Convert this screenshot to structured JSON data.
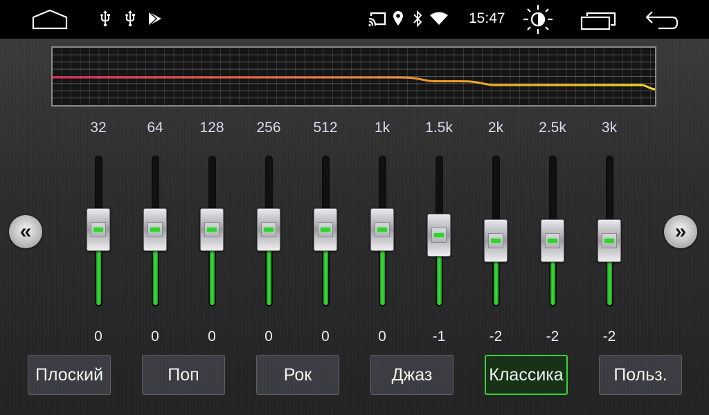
{
  "status_bar": {
    "left_icons": [
      "home-icon",
      "usb-icon",
      "usb-icon",
      "play-store-icon"
    ],
    "right_icons": [
      "cast-icon",
      "location-icon",
      "bluetooth-icon",
      "wifi-icon"
    ],
    "time": "15:47",
    "controls": [
      "brightness-icon",
      "recent-apps-icon",
      "back-icon"
    ]
  },
  "equalizer": {
    "range": {
      "min": -12,
      "max": 12
    },
    "bands": [
      {
        "freq": "32",
        "value": 0,
        "label": "0"
      },
      {
        "freq": "64",
        "value": 0,
        "label": "0"
      },
      {
        "freq": "128",
        "value": 0,
        "label": "0"
      },
      {
        "freq": "256",
        "value": 0,
        "label": "0"
      },
      {
        "freq": "512",
        "value": 0,
        "label": "0"
      },
      {
        "freq": "1k",
        "value": 0,
        "label": "0"
      },
      {
        "freq": "1.5k",
        "value": -1,
        "label": "-1"
      },
      {
        "freq": "2k",
        "value": -2,
        "label": "-2"
      },
      {
        "freq": "2.5k",
        "value": -2,
        "label": "-2"
      },
      {
        "freq": "3k",
        "value": -2,
        "label": "-2"
      }
    ],
    "curve_colors": {
      "start": "#e8245a",
      "mid": "#f08a30",
      "end": "#f3dc1c"
    },
    "prev_icon": "double-chevron-left-icon",
    "next_icon": "double-chevron-right-icon",
    "prev_glyph": "«",
    "next_glyph": "»"
  },
  "presets": [
    {
      "label": "Плоский",
      "active": false
    },
    {
      "label": "Поп",
      "active": false
    },
    {
      "label": "Рок",
      "active": false
    },
    {
      "label": "Джаз",
      "active": false
    },
    {
      "label": "Классика",
      "active": true
    },
    {
      "label": "Польз.",
      "active": false
    }
  ],
  "colors": {
    "accent": "#3ad23a",
    "fill": "#2fd22f"
  }
}
